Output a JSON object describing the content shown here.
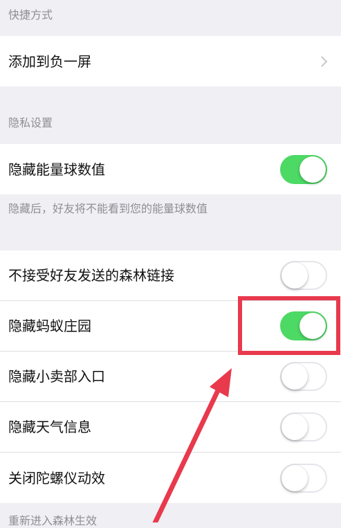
{
  "sections": {
    "shortcuts": {
      "header": "快捷方式",
      "items": [
        {
          "label": "添加到负一屏",
          "control": "chevron"
        }
      ]
    },
    "privacy": {
      "header": "隐私设置",
      "items": [
        {
          "label": "隐藏能量球数值",
          "control": "toggle",
          "on": true
        }
      ],
      "footnote": "隐藏后，好友将不能看到您的能量球数值"
    },
    "more": {
      "items": [
        {
          "label": "不接受好友发送的森林链接",
          "control": "toggle",
          "on": false
        },
        {
          "label": "隐藏蚂蚁庄园",
          "control": "toggle",
          "on": true
        },
        {
          "label": "隐藏小卖部入口",
          "control": "toggle",
          "on": false
        },
        {
          "label": "隐藏天气信息",
          "control": "toggle",
          "on": false
        },
        {
          "label": "关闭陀螺仪动效",
          "control": "toggle",
          "on": false
        }
      ]
    },
    "next": {
      "header": "重新进入森林生效"
    }
  },
  "colors": {
    "background": "#efeff4",
    "toggle_on": "#4cd964",
    "annotation": "#e8394d",
    "secondary_text": "#8e8e93"
  }
}
